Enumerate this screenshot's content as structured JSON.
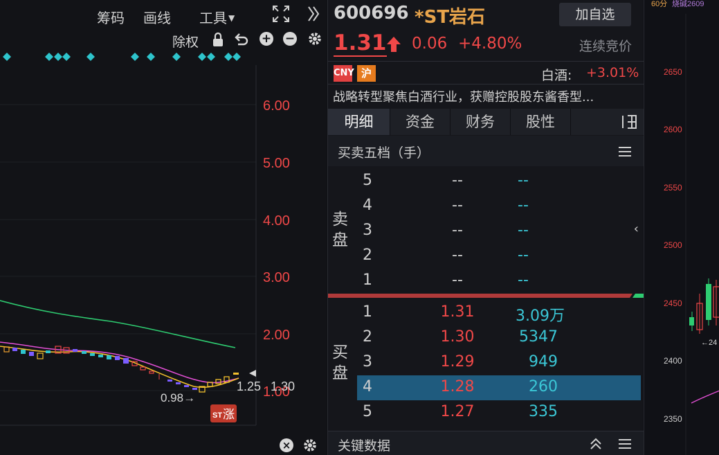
{
  "chart_toolbar": {
    "chips_label": "筹码",
    "draw_label": "画线",
    "tools_label": "工具",
    "exright_label": "除权"
  },
  "chart": {
    "y_ticks": [
      "6.00",
      "5.00",
      "4.00",
      "3.00",
      "2.00",
      "1.00"
    ],
    "low_annotation": "0.98→",
    "last_annotation": "1.25",
    "right_annotation": "1.30",
    "limit_up_badge": "涨",
    "limit_up_prefix": "ST"
  },
  "quote": {
    "code": "600696",
    "name": "*ST岩石",
    "watch_button": "加自选",
    "price": "1.31",
    "change": "0.06",
    "change_pct": "+4.80%",
    "status": "连续竞价",
    "badge_cny": "CNY",
    "badge_exchange": "沪",
    "sector_name": "白酒:",
    "sector_change": "+3.01%",
    "news": "战略转型聚焦白酒行业，获赠控股股东酱香型..."
  },
  "tabs": [
    {
      "label": "明细"
    },
    {
      "label": "资金"
    },
    {
      "label": "财务"
    },
    {
      "label": "股性"
    }
  ],
  "orderbook": {
    "title": "买卖五档（手）",
    "sell_label": "卖盘",
    "buy_label": "买盘",
    "sell": [
      {
        "level": "5",
        "price": "--",
        "vol": "--"
      },
      {
        "level": "4",
        "price": "--",
        "vol": "--"
      },
      {
        "level": "3",
        "price": "--",
        "vol": "--"
      },
      {
        "level": "2",
        "price": "--",
        "vol": "--"
      },
      {
        "level": "1",
        "price": "--",
        "vol": "--"
      }
    ],
    "buy": [
      {
        "level": "1",
        "price": "1.31",
        "vol": "3.09万"
      },
      {
        "level": "2",
        "price": "1.30",
        "vol": "5347"
      },
      {
        "level": "3",
        "price": "1.29",
        "vol": "949"
      },
      {
        "level": "4",
        "price": "1.28",
        "vol": "260"
      },
      {
        "level": "5",
        "price": "1.27",
        "vol": "335"
      }
    ]
  },
  "key_data_title": "关键数据",
  "index_panel": {
    "period": "60分",
    "indicator": "烧碱2609",
    "y_ticks": [
      "2650",
      "2600",
      "2550",
      "2500",
      "2450",
      "2400",
      "2350"
    ],
    "marker": "←24"
  },
  "colors": {
    "up": "#f04848",
    "down": "#2ecc71",
    "accent_blue": "#3bc7d6",
    "stock_name": "#e8a44b",
    "highlight_row": "#1f5b7e"
  }
}
